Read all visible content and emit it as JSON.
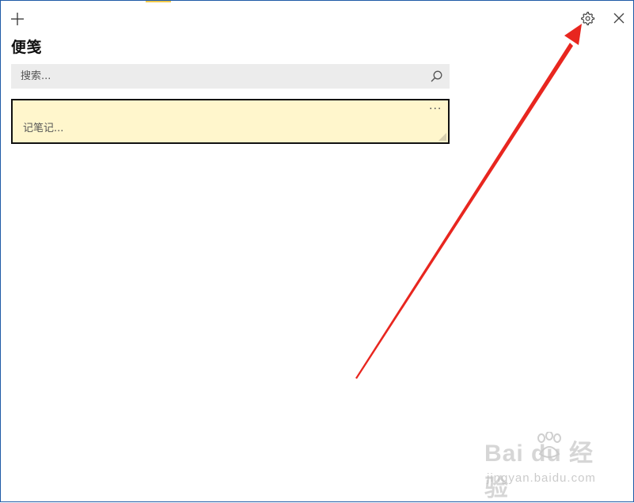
{
  "app": {
    "title": "便笺"
  },
  "toolbar": {
    "add_icon": "plus-icon",
    "settings_icon": "gear-icon",
    "close_icon": "close-icon"
  },
  "search": {
    "placeholder": "搜索...",
    "value": "",
    "icon": "search-icon"
  },
  "notes": [
    {
      "text": "记笔记...",
      "more_label": "···",
      "background": "#fff6cc"
    }
  ],
  "annotation": {
    "type": "arrow",
    "color": "#e8261f"
  },
  "watermark": {
    "brand": "Bai  du 经验",
    "url": "jingyan.baidu.com"
  },
  "colors": {
    "window_border": "#1e5aa6",
    "search_bg": "#ececec",
    "note_bg": "#fff6cc"
  }
}
